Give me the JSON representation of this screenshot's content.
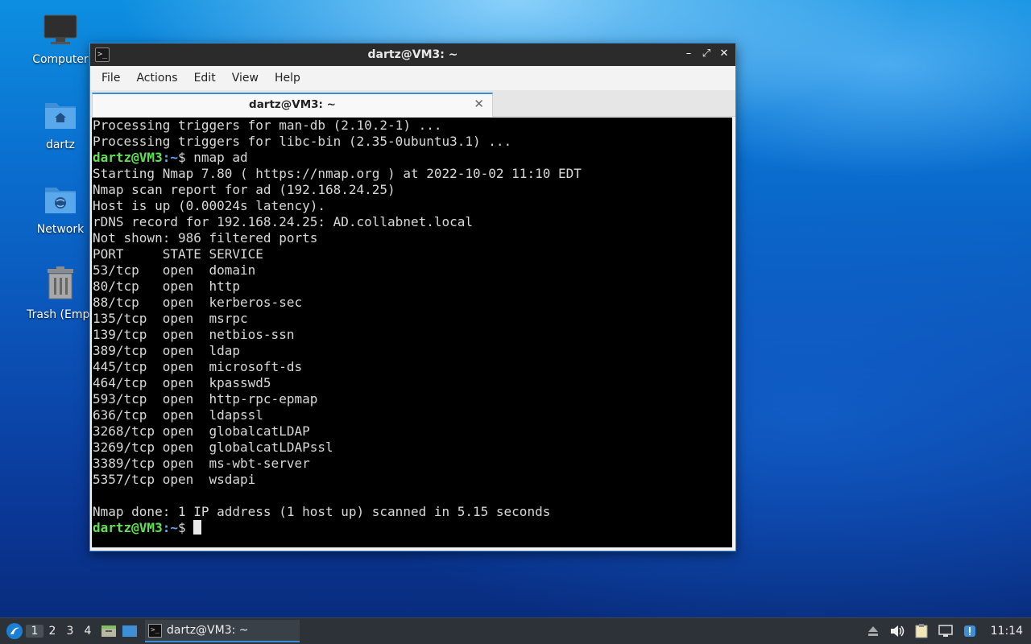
{
  "desktop": {
    "icons": [
      {
        "label": "Computer"
      },
      {
        "label": "dartz"
      },
      {
        "label": "Network"
      },
      {
        "label": "Trash (Empt"
      }
    ]
  },
  "window": {
    "title": "dartz@VM3: ~",
    "controls": {
      "minimize": "–",
      "maximize": "⤢",
      "close": "✕"
    },
    "menu": [
      "File",
      "Actions",
      "Edit",
      "View",
      "Help"
    ],
    "tab": {
      "label": "dartz@VM3: ~",
      "close": "✕"
    }
  },
  "terminal": {
    "prompt_user": "dartz@VM3",
    "prompt_path": ":~",
    "prompt_symbol": "$",
    "lines": [
      {
        "type": "text",
        "text": "Processing triggers for man-db (2.10.2-1) ..."
      },
      {
        "type": "text",
        "text": "Processing triggers for libc-bin (2.35-0ubuntu3.1) ..."
      },
      {
        "type": "prompt",
        "text": " nmap ad"
      },
      {
        "type": "text",
        "text": "Starting Nmap 7.80 ( https://nmap.org ) at 2022-10-02 11:10 EDT"
      },
      {
        "type": "text",
        "text": "Nmap scan report for ad (192.168.24.25)"
      },
      {
        "type": "text",
        "text": "Host is up (0.00024s latency)."
      },
      {
        "type": "text",
        "text": "rDNS record for 192.168.24.25: AD.collabnet.local"
      },
      {
        "type": "text",
        "text": "Not shown: 986 filtered ports"
      },
      {
        "type": "text",
        "text": "PORT     STATE SERVICE"
      },
      {
        "type": "text",
        "text": "53/tcp   open  domain"
      },
      {
        "type": "text",
        "text": "80/tcp   open  http"
      },
      {
        "type": "text",
        "text": "88/tcp   open  kerberos-sec"
      },
      {
        "type": "text",
        "text": "135/tcp  open  msrpc"
      },
      {
        "type": "text",
        "text": "139/tcp  open  netbios-ssn"
      },
      {
        "type": "text",
        "text": "389/tcp  open  ldap"
      },
      {
        "type": "text",
        "text": "445/tcp  open  microsoft-ds"
      },
      {
        "type": "text",
        "text": "464/tcp  open  kpasswd5"
      },
      {
        "type": "text",
        "text": "593/tcp  open  http-rpc-epmap"
      },
      {
        "type": "text",
        "text": "636/tcp  open  ldapssl"
      },
      {
        "type": "text",
        "text": "3268/tcp open  globalcatLDAP"
      },
      {
        "type": "text",
        "text": "3269/tcp open  globalcatLDAPssl"
      },
      {
        "type": "text",
        "text": "3389/tcp open  ms-wbt-server"
      },
      {
        "type": "text",
        "text": "5357/tcp open  wsdapi"
      },
      {
        "type": "text",
        "text": ""
      },
      {
        "type": "text",
        "text": "Nmap done: 1 IP address (1 host up) scanned in 5.15 seconds"
      },
      {
        "type": "prompt",
        "text": " ",
        "cursor": true
      }
    ]
  },
  "taskbar": {
    "workspaces": [
      "1",
      "2",
      "3",
      "4"
    ],
    "active_workspace": "1",
    "task_label": "dartz@VM3: ~",
    "clock": "11:14"
  },
  "colors": {
    "prompt_user": "#5fe24f",
    "prompt_path": "#5fa8f0",
    "accent": "#3b8fd9",
    "terminal_bg": "#000000"
  }
}
